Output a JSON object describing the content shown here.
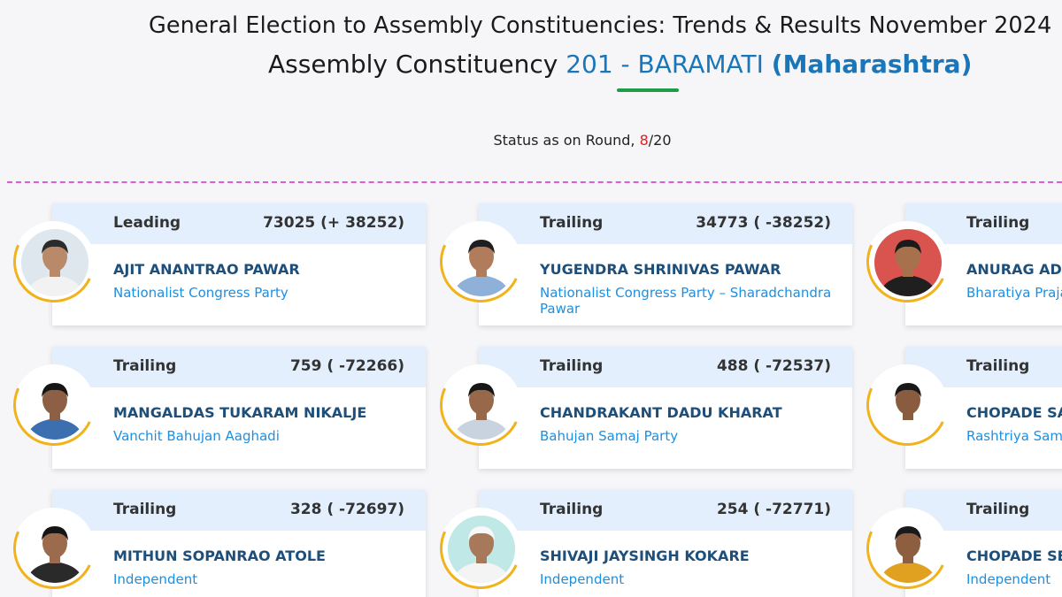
{
  "header": {
    "title_line1": "General Election to Assembly Constituencies: Trends & Results November 2024",
    "title_prefix": "Assembly Constituency",
    "ac_number_name": "201 - BARAMATI",
    "state": "(Maharashtra)"
  },
  "status": {
    "prefix": "Status as on Round,",
    "current_round": "8",
    "total_rounds": "/20"
  },
  "candidates": [
    {
      "status": "Leading",
      "votes": "73025 (+ 38252)",
      "name": "AJIT ANANTRAO PAWAR",
      "party": "Nationalist Congress Party",
      "shirt": "#f2f2f2",
      "skin": "#b98a6a",
      "hair": "#2b2b2b",
      "bg": "#dfe7ee"
    },
    {
      "status": "Trailing",
      "votes": "34773 ( -38252)",
      "name": "YUGENDRA SHRINIVAS PAWAR",
      "party": "Nationalist Congress Party – Sharadchandra Pawar",
      "shirt": "#8fb0d8",
      "skin": "#b17c5c",
      "hair": "#1f1f1f",
      "bg": "#ffffff"
    },
    {
      "status": "Trailing",
      "votes": "",
      "name": "ANURAG ADINATH KHALATE",
      "party": "Bharatiya Praja Party",
      "shirt": "#1f1f1f",
      "skin": "#a8714e",
      "hair": "#1b1b1b",
      "bg": "#d9534f"
    },
    {
      "status": "Trailing",
      "votes": "759 ( -72266)",
      "name": "MANGALDAS TUKARAM NIKALJE",
      "party": "Vanchit Bahujan Aaghadi",
      "shirt": "#3c6fb0",
      "skin": "#8d5f44",
      "hair": "#151515",
      "bg": "#ffffff"
    },
    {
      "status": "Trailing",
      "votes": "488 ( -72537)",
      "name": "CHANDRAKANT DADU KHARAT",
      "party": "Bahujan Samaj Party",
      "shirt": "#c9d3df",
      "skin": "#98684b",
      "hair": "#171717",
      "bg": "#ffffff"
    },
    {
      "status": "Trailing",
      "votes": "",
      "name": "CHOPADE SACHIN",
      "party": "Rashtriya Samaj Paksha",
      "shirt": "#ffffff",
      "skin": "#8a5c3f",
      "hair": "#181818",
      "bg": "#ffffff"
    },
    {
      "status": "Trailing",
      "votes": "328 ( -72697)",
      "name": "MITHUN SOPANRAO ATOLE",
      "party": "Independent",
      "shirt": "#2a2a2a",
      "skin": "#9c6a4c",
      "hair": "#151515",
      "bg": "#ffffff"
    },
    {
      "status": "Trailing",
      "votes": "254 ( -72771)",
      "name": "SHIVAJI JAYSINGH KOKARE",
      "party": "Independent",
      "shirt": "#f4f4f4",
      "skin": "#a7785a",
      "hair": "#f7f7f7",
      "bg": "#bfe8e6"
    },
    {
      "status": "Trailing",
      "votes": "",
      "name": "CHOPADE SEEMA",
      "party": "Independent",
      "shirt": "#e0a020",
      "skin": "#8e5e40",
      "hair": "#1a1a1a",
      "bg": "#ffffff"
    }
  ]
}
